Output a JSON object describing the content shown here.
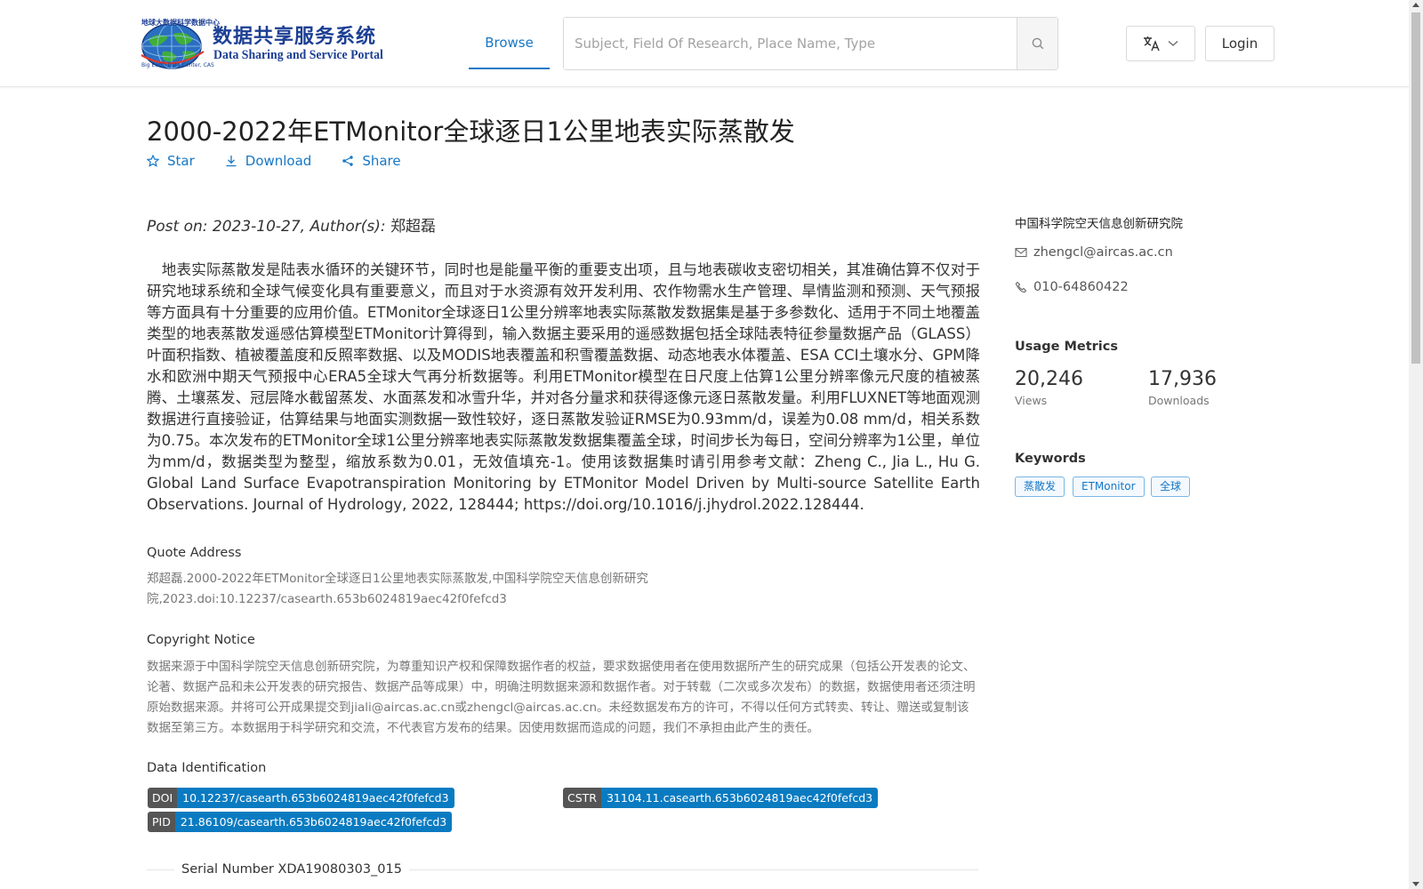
{
  "header": {
    "logo_cn": "数据共享服务系统",
    "logo_en": "Data Sharing and Service Portal",
    "logo_ring_top": "地球大数据科学数据中心",
    "logo_ring_bottom": "Big Earth Data Center, CAS",
    "nav_browse": "Browse",
    "search_placeholder": "Subject, Field Of Research, Place Name, Type",
    "login_label": "Login",
    "icons": {
      "search": "search-icon",
      "language": "translate-icon",
      "chevron": "chevron-down-icon"
    }
  },
  "dataset": {
    "title": "2000-2022年ETMonitor全球逐日1公里地表实际蒸散发",
    "actions": {
      "star": "Star",
      "download": "Download",
      "share": "Share"
    },
    "post_line": "Post on: 2023-10-27, Author(s): ",
    "author": "郑超磊",
    "abstract": "　地表实际蒸散发是陆表水循环的关键环节，同时也是能量平衡的重要支出项，且与地表碳收支密切相关，其准确估算不仅对于研究地球系统和全球气候变化具有重要意义，而且对于水资源有效开发利用、农作物需水生产管理、旱情监测和预测、天气预报等方面具有十分重要的应用价值。ETMonitor全球逐日1公里分辨率地表实际蒸散发数据集是基于多参数化、适用于不同土地覆盖类型的地表蒸散发遥感估算模型ETMonitor计算得到，输入数据主要采用的遥感数据包括全球陆表特征参量数据产品（GLASS）叶面积指数、植被覆盖度和反照率数据、以及MODIS地表覆盖和积雪覆盖数据、动态地表水体覆盖、ESA CCI土壤水分、GPM降水和欧洲中期天气预报中心ERA5全球大气再分析数据等。利用ETMonitor模型在日尺度上估算1公里分辨率像元尺度的植被蒸腾、土壤蒸发、冠层降水截留蒸发、水面蒸发和冰雪升华，并对各分量求和获得逐像元逐日蒸散发量。利用FLUXNET等地面观测数据进行直接验证，估算结果与地面实测数据一致性较好，逐日蒸散发验证RMSE为0.93mm/d，误差为0.08 mm/d，相关系数为0.75。本次发布的ETMonitor全球1公里分辨率地表实际蒸散发数据集覆盖全球，时间步长为每日，空间分辨率为1公里，单位为mm/d，数据类型为整型，缩放系数为0.01，无效值填充-1。使用该数据集时请引用参考文献：Zheng C., Jia L., Hu G. Global Land Surface Evapotranspiration Monitoring by ETMonitor Model Driven by Multi-source Satellite Earth Observations. Journal of Hydrology, 2022, 128444; https://doi.org/10.1016/j.jhydrol.2022.128444.",
    "quote_title": "Quote Address",
    "quote_text": "郑超磊.2000-2022年ETMonitor全球逐日1公里地表实际蒸散发,中国科学院空天信息创新研究院,2023.doi:10.12237/casearth.653b6024819aec42f0fefcd3",
    "copyright_title": "Copyright Notice",
    "copyright_text": "数据来源于中国科学院空天信息创新研究院，为尊重知识产权和保障数据作者的权益，要求数据使用者在使用数据所产生的研究成果（包括公开发表的论文、论著、数据产品和未公开发表的研究报告、数据产品等成果）中，明确注明数据来源和数据作者。对于转载（二次或多次发布）的数据，数据使用者还须注明原始数据来源。并将可公开成果提交到jiali@aircas.ac.cn或zhengcl@aircas.ac.cn。未经数据发布方的许可，不得以任何方式转卖、转让、赠送或复制该数据至第三方。本数据用于科学研究和交流，不代表官方发布的结果。因使用数据而造成的问题，我们不承担由此产生的责任。",
    "identification_title": "Data Identification",
    "identifiers": {
      "doi_key": "DOI",
      "doi": "10.12237/casearth.653b6024819aec42f0fefcd3",
      "cstr_key": "CSTR",
      "cstr": "31104.11.casearth.653b6024819aec42f0fefcd3",
      "pid_key": "PID",
      "pid": "21.86109/casearth.653b6024819aec42f0fefcd3"
    },
    "serial": "Serial Number XDA19080303_015"
  },
  "sidebar": {
    "organization": "中国科学院空天信息创新研究院",
    "email": "zhengcl@aircas.ac.cn",
    "phone": "010-64860422",
    "metrics_title": "Usage Metrics",
    "views": "20,246",
    "views_label": "Views",
    "downloads": "17,936",
    "downloads_label": "Downloads",
    "keywords_title": "Keywords",
    "keywords": [
      "蒸散发",
      "ETMonitor",
      "全球"
    ]
  },
  "colors": {
    "accent": "#1677c5",
    "badge_key": "#555555",
    "badge_value": "#0a7bc1",
    "logo": "#1c3f94"
  }
}
